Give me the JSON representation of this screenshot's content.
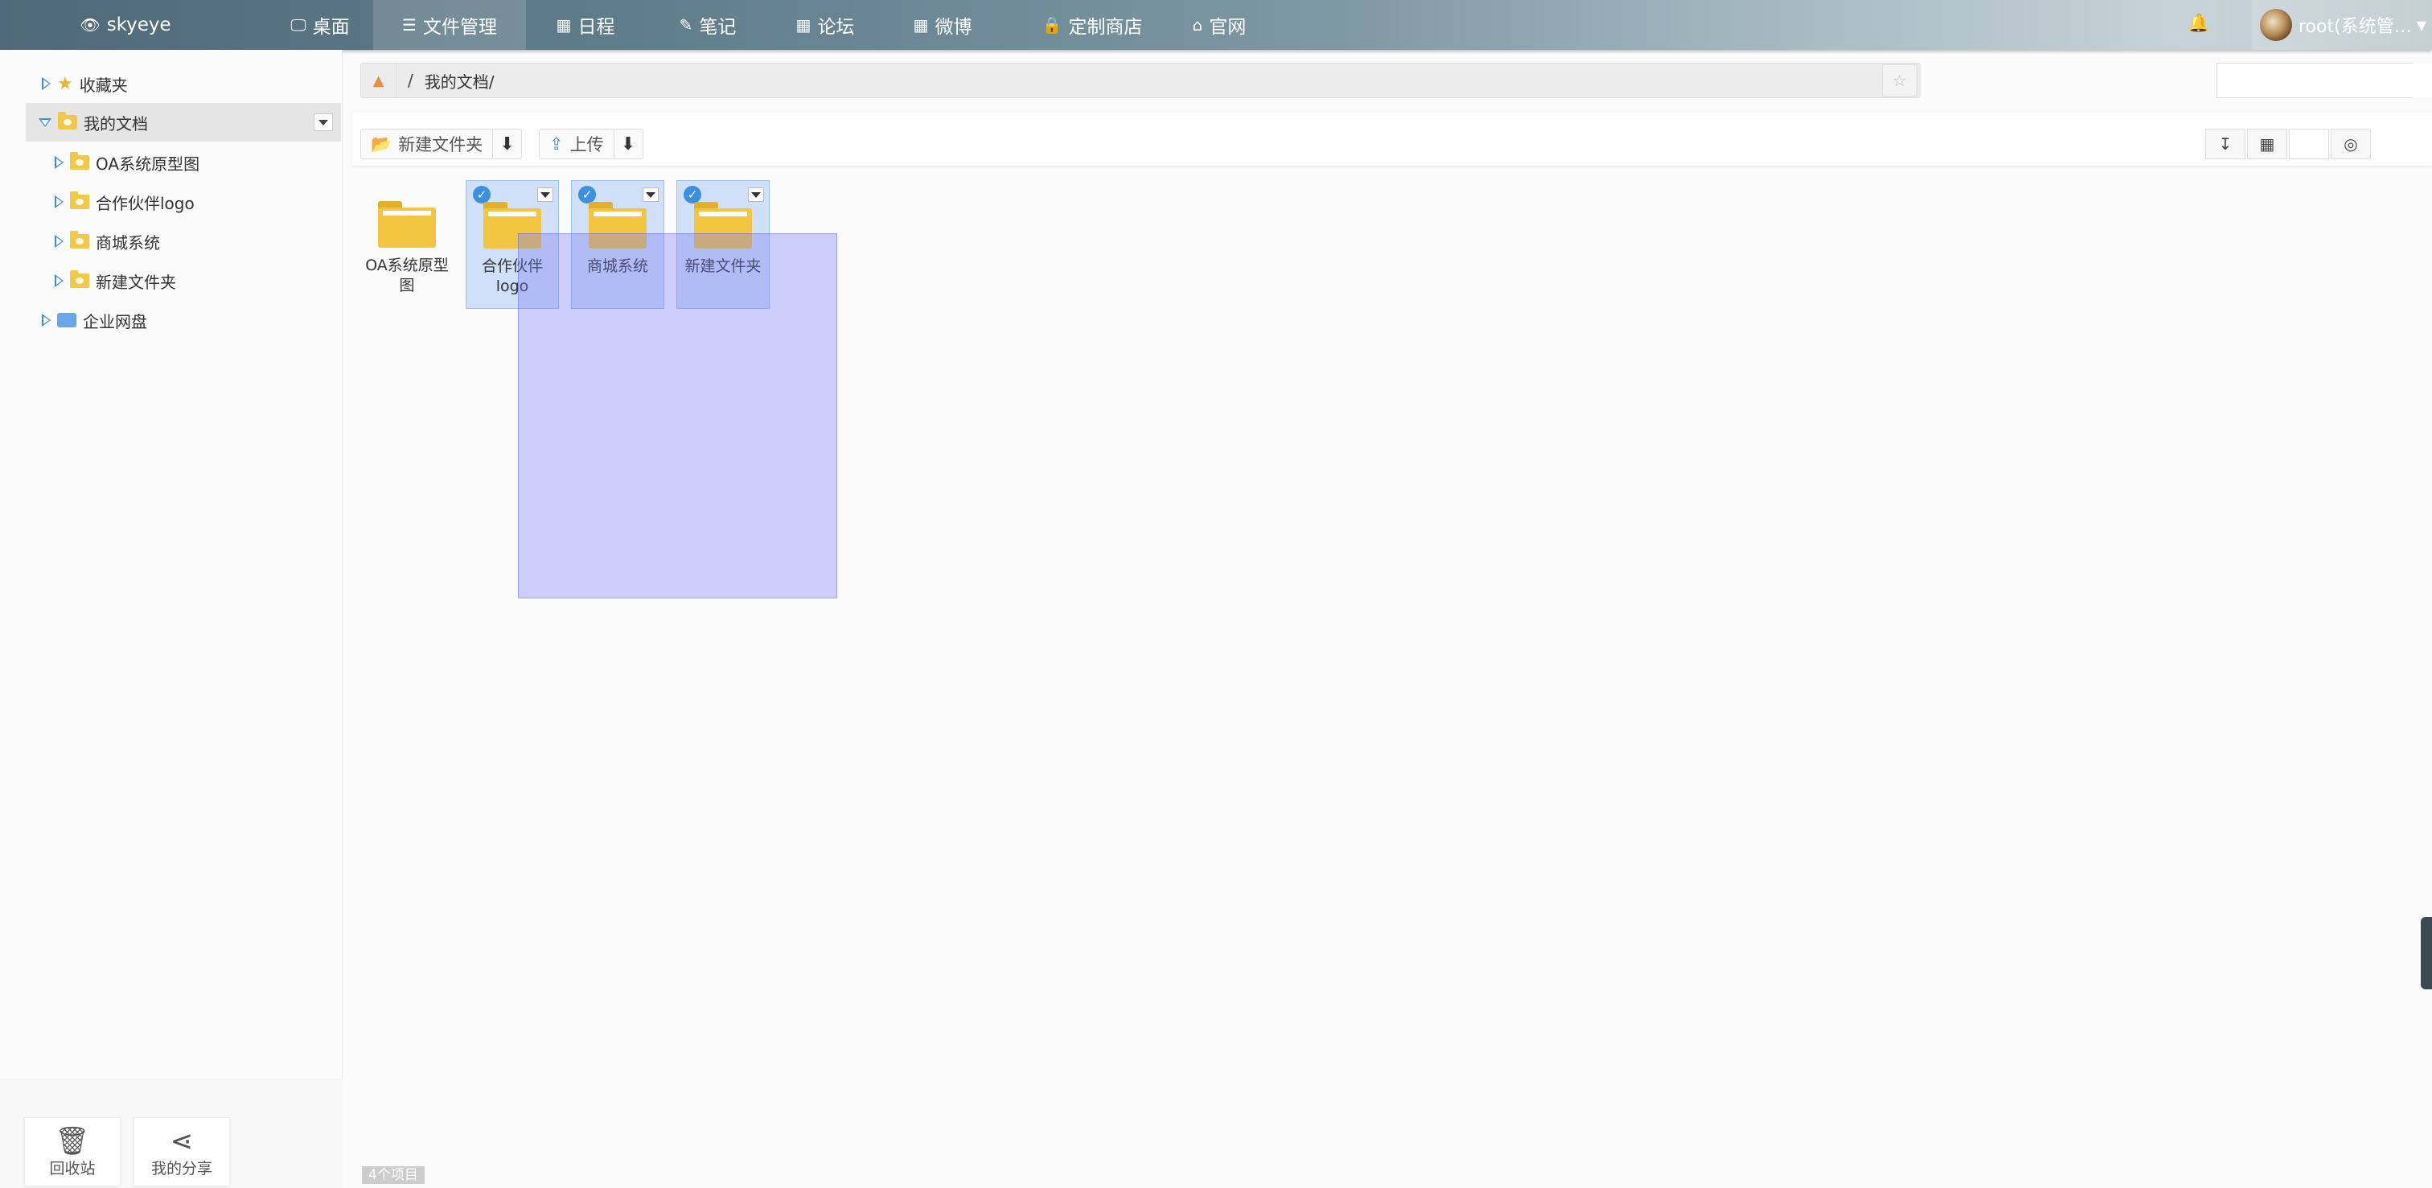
{
  "topbar": {
    "brand": "skyeye",
    "nav": [
      {
        "label": "桌面",
        "icon": "desktop-icon"
      },
      {
        "label": "文件管理",
        "icon": "list-icon"
      },
      {
        "label": "日程",
        "icon": "calendar-icon"
      },
      {
        "label": "笔记",
        "icon": "edit-icon"
      },
      {
        "label": "论坛",
        "icon": "calendar-icon"
      },
      {
        "label": "微博",
        "icon": "calendar-icon"
      },
      {
        "label": "定制商店",
        "icon": "lock-icon"
      },
      {
        "label": "官网",
        "icon": "home-icon"
      }
    ],
    "active": "文件管理",
    "user": "root(系统管…"
  },
  "sidebar": {
    "tree": [
      {
        "label": "收藏夹",
        "icon": "star-icon"
      },
      {
        "label": "我的文档",
        "icon": "folder-icon",
        "expanded": true
      },
      {
        "label": "OA系统原型图",
        "icon": "folder-icon"
      },
      {
        "label": "合作伙伴logo",
        "icon": "folder-icon"
      },
      {
        "label": "商城系统",
        "icon": "folder-icon"
      },
      {
        "label": "新建文件夹",
        "icon": "folder-icon"
      },
      {
        "label": "企业网盘",
        "icon": "disk-icon"
      }
    ],
    "bottom": {
      "recycle": "回收站",
      "share": "我的分享"
    }
  },
  "address": {
    "separator": "/",
    "path": "我的文档/"
  },
  "toolbar": {
    "new_folder": "新建文件夹",
    "upload": "上传"
  },
  "files": [
    {
      "name": "OA系统原型图",
      "selected": false
    },
    {
      "name": "合作伙伴logo",
      "selected": true
    },
    {
      "name": "商城系统",
      "selected": true
    },
    {
      "name": "新建文件夹",
      "selected": true
    }
  ],
  "status": "4个项目",
  "colors": {
    "accent": "#3e8ed0",
    "folder": "#f2c641",
    "selection": "#cfe0f8",
    "lasso": "#7878f5"
  }
}
